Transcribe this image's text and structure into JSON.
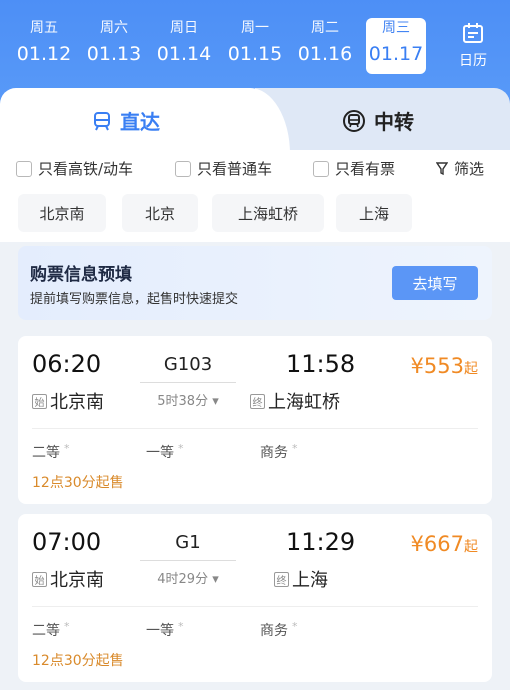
{
  "dates": [
    {
      "weekday": "周五",
      "date": "01.12",
      "active": false
    },
    {
      "weekday": "周六",
      "date": "01.13",
      "active": false
    },
    {
      "weekday": "周日",
      "date": "01.14",
      "active": false
    },
    {
      "weekday": "周一",
      "date": "01.15",
      "active": false
    },
    {
      "weekday": "周二",
      "date": "01.16",
      "active": false
    },
    {
      "weekday": "周三",
      "date": "01.17",
      "active": true
    }
  ],
  "calendar_label": "日历",
  "tabs": {
    "direct": "直达",
    "transfer": "中转"
  },
  "filters": [
    "只看高铁/动车",
    "只看普通车",
    "只看有票"
  ],
  "filter_button": "筛选",
  "stations": [
    "北京南",
    "北京",
    "上海虹桥",
    "上海"
  ],
  "prefill": {
    "title": "购票信息预填",
    "subtitle": "提前填写购票信息，起售时快速提交",
    "button": "去填写"
  },
  "trains": [
    {
      "dep_time": "06:20",
      "arr_time": "11:58",
      "number": "G103",
      "duration": "5时38分",
      "dep_tag": "始",
      "dep_station": "北京南",
      "arr_tag": "终",
      "arr_station": "上海虹桥",
      "price": "¥553",
      "price_suffix": "起",
      "seats": [
        "二等",
        "一等",
        "商务"
      ],
      "seat_mark": "*",
      "sale_time": "12点30分起售"
    },
    {
      "dep_time": "07:00",
      "arr_time": "11:29",
      "number": "G1",
      "duration": "4时29分",
      "dep_tag": "始",
      "dep_station": "北京南",
      "arr_tag": "终",
      "arr_station": "上海",
      "price": "¥667",
      "price_suffix": "起",
      "seats": [
        "二等",
        "一等",
        "商务"
      ],
      "seat_mark": "*",
      "sale_time": "12点30分起售"
    }
  ],
  "colors": {
    "primary": "#3a7ff3",
    "header": "#4d8ff6",
    "price": "#f08a24",
    "sale": "#d98a2b"
  }
}
